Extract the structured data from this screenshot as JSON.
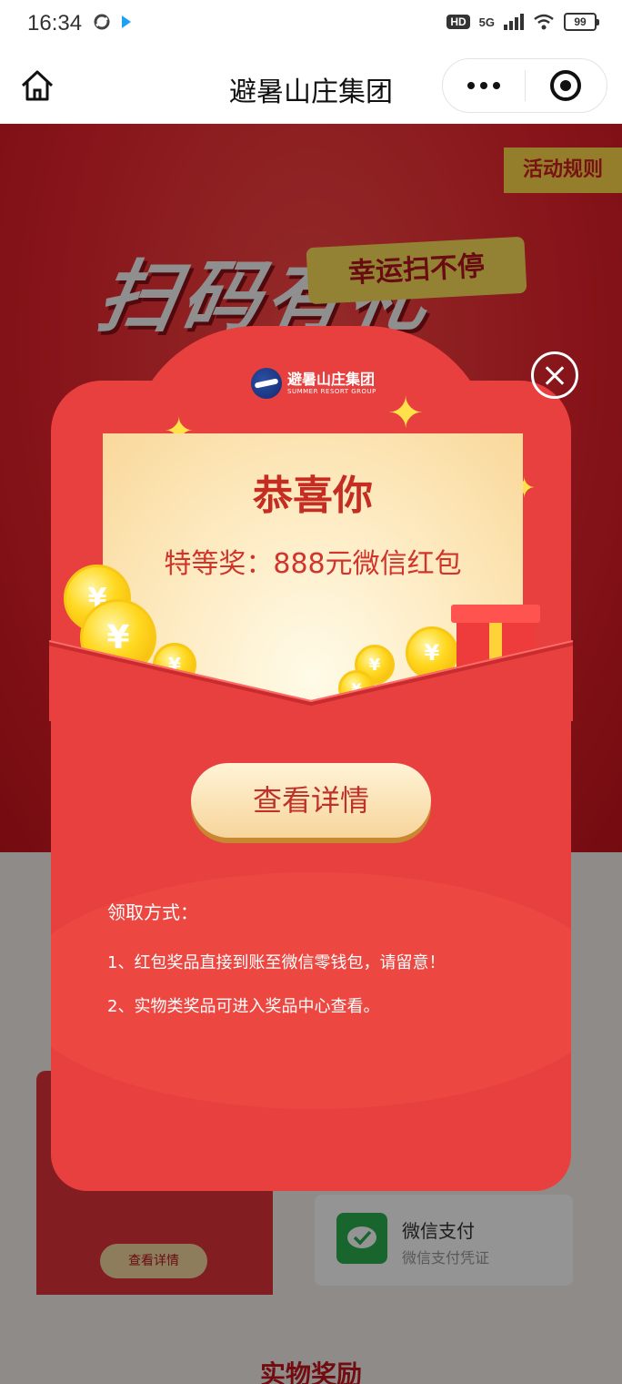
{
  "status_bar": {
    "time": "16:34",
    "network": "5G",
    "hd": "HD",
    "battery": "99"
  },
  "nav": {
    "title": "避暑山庄集团",
    "icons": {
      "home": "home-icon",
      "more": "more-icon",
      "close": "miniprogram-close-icon"
    }
  },
  "background": {
    "rules_tag": "活动规则",
    "banner_big": "扫码有礼",
    "banner_pill": "幸运扫不停",
    "card_button": "查看详情",
    "wechat_pay": {
      "title": "微信支付",
      "subtitle": "微信支付凭证"
    },
    "bottom_title": "实物奖励"
  },
  "modal": {
    "logo": {
      "cn": "避暑山庄集团",
      "en": "SUMMER RESORT GROUP"
    },
    "title": "恭喜你",
    "prize": "特等奖：888元微信红包",
    "button": "查看详情",
    "instructions": {
      "title": "领取方式：",
      "lines": [
        "1、红包奖品直接到账至微信零钱包，请留意！",
        "2、实物类奖品可进入奖品中心查看。"
      ]
    }
  },
  "colors": {
    "modal_red": "#e8403f",
    "gold": "#ffd81f",
    "button_text": "#c0312a",
    "wechat_green": "#2aae4f"
  }
}
